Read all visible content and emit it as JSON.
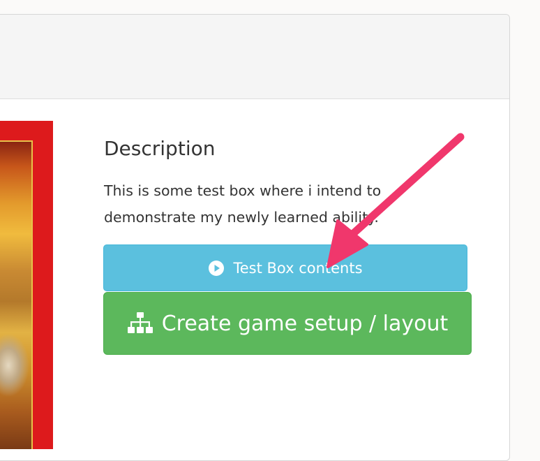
{
  "main": {
    "description_heading": "Description",
    "description_text": "This is some test box where i intend to demonstrate my newly learned ability.",
    "test_button_label": "Test Box contents",
    "create_button_label": "Create game setup / layout"
  },
  "icons": {
    "test_button_icon": "play-circle-icon",
    "create_button_icon": "sitemap-icon",
    "annotation": "arrow-icon"
  },
  "colors": {
    "info_button": "#5bc0de",
    "success_button": "#5cb85c",
    "annotation_arrow": "#f0376c",
    "box_frame": "#dd1a1c"
  }
}
